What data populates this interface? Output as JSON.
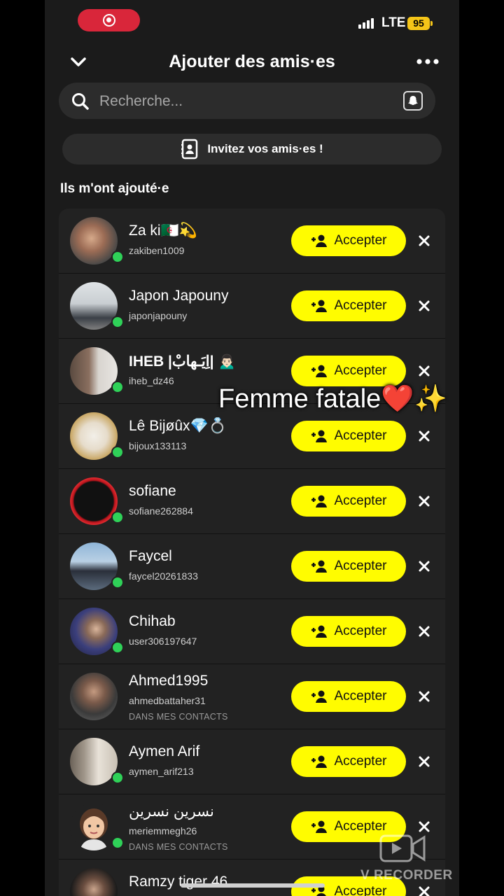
{
  "status": {
    "network": "LTE",
    "battery": "95"
  },
  "header": {
    "title": "Ajouter des amis·es"
  },
  "search": {
    "placeholder": "Recherche..."
  },
  "invite": {
    "label": "Invitez vos amis·es !"
  },
  "section": {
    "title": "Ils m'ont ajouté·e"
  },
  "accept_label": "Accepter",
  "rows": [
    {
      "name": "Za ki🇩🇿💫",
      "username": "zakiben1009",
      "contact": ""
    },
    {
      "name": "Japon Japouny",
      "username": "japonjapouny",
      "contact": ""
    },
    {
      "name": "IHEB |اِيَـهابْ| 🙍🏻‍♂️",
      "username": "iheb_dz46",
      "contact": ""
    },
    {
      "name": "Lê Bijøûx💎💍",
      "username": "bijoux133113",
      "contact": ""
    },
    {
      "name": "sofiane",
      "username": "sofiane262884",
      "contact": ""
    },
    {
      "name": "Faycel",
      "username": "faycel20261833",
      "contact": ""
    },
    {
      "name": "Chihab",
      "username": "user306197647",
      "contact": ""
    },
    {
      "name": "Ahmed1995",
      "username": "ahmedbattaher31",
      "contact": "DANS MES CONTACTS"
    },
    {
      "name": "Aymen Arif",
      "username": "aymen_arif213",
      "contact": ""
    },
    {
      "name": "نسرين نسرين",
      "username": "meriemmegh26",
      "contact": "DANS MES CONTACTS"
    },
    {
      "name": "Ramzy tiger 46",
      "username": "",
      "contact": ""
    }
  ],
  "overlay": {
    "text": "Femme fatale❤️✨"
  },
  "watermark": {
    "text": "V RECORDER"
  },
  "colors": {
    "accent": "#fffc00",
    "online": "#2fd158",
    "record": "#d9263a",
    "battery": "#f5c518"
  },
  "icons": [
    "record-icon",
    "signal-icon",
    "chevron-down-icon",
    "more-icon",
    "search-icon",
    "ghost-icon",
    "contacts-icon",
    "add-friend-icon",
    "close-icon"
  ]
}
